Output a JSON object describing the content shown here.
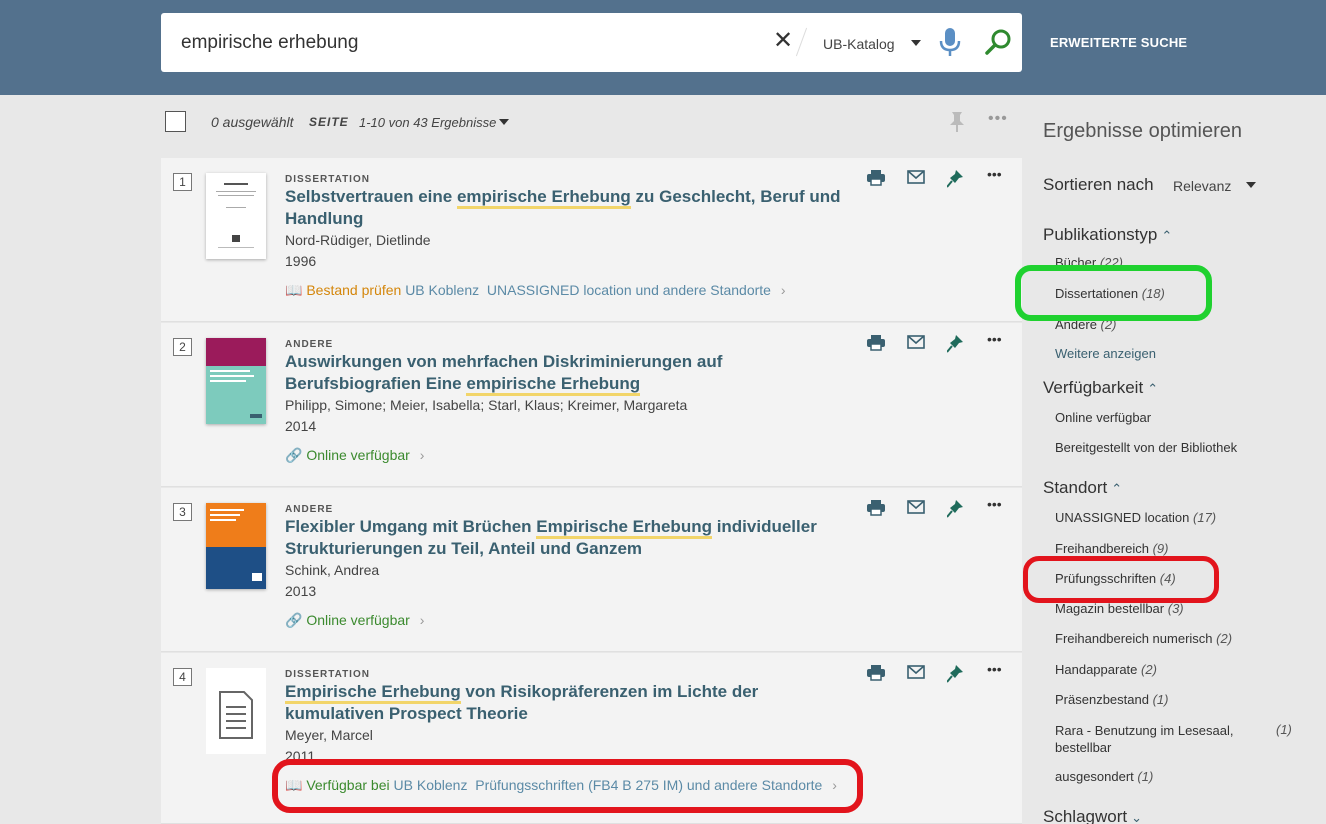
{
  "search": {
    "query": "empirische erhebung",
    "scope": "UB-Katalog",
    "advanced_label": "ERWEITERTE SUCHE"
  },
  "toolbar": {
    "selected": "0 ausgewählt",
    "page_label": "SEITE",
    "range": "1-10 von 43 Ergebnisse"
  },
  "results": [
    {
      "num": "1",
      "type": "DISSERTATION",
      "title_parts": [
        "Selbstvertrauen eine ",
        "empirische Erhebung",
        " zu Geschlecht, Beruf und Handlung"
      ],
      "author": "Nord-Rüdiger, Dietlinde",
      "year": "1996",
      "avail_status": "Bestand prüfen",
      "avail_library": "UB Koblenz",
      "avail_location": "UNASSIGNED location und andere Standorte"
    },
    {
      "num": "2",
      "type": "ANDERE",
      "title_parts": [
        "Auswirkungen von mehrfachen Diskriminierungen auf Berufsbiografien Eine ",
        "empirische Erhebung",
        ""
      ],
      "author": "Philipp, Simone; Meier, Isabella; Starl, Klaus; Kreimer, Margareta",
      "year": "2014",
      "avail_status": "Online verfügbar"
    },
    {
      "num": "3",
      "type": "ANDERE",
      "title_parts": [
        "Flexibler Umgang mit Brüchen ",
        "Empirische Erhebung",
        " individueller Strukturierungen zu Teil, Anteil und Ganzem"
      ],
      "author": "Schink, Andrea",
      "year": "2013",
      "avail_status": "Online verfügbar"
    },
    {
      "num": "4",
      "type": "DISSERTATION",
      "title_parts": [
        "",
        "Empirische Erhebung",
        " von Risikopräferenzen im Lichte der kumulativen Prospect Theorie"
      ],
      "author": "Meyer, Marcel",
      "year": "2011",
      "avail_status": "Verfügbar bei",
      "avail_library": "UB Koblenz",
      "avail_location": "Prüfungsschriften (FB4 B 275 IM) und andere Standorte"
    }
  ],
  "sidebar": {
    "title": "Ergebnisse optimieren",
    "sort_label": "Sortieren nach",
    "sort_value": "Relevanz",
    "pubtype_head": "Publikationstyp",
    "pubtype": [
      {
        "label": "Bücher",
        "count": "(22)"
      },
      {
        "label": "Dissertationen",
        "count": "(18)"
      },
      {
        "label": "Andere",
        "count": "(2)"
      }
    ],
    "more_label": "Weitere anzeigen",
    "avail_head": "Verfügbarkeit",
    "avail": [
      "Online verfügbar",
      "Bereitgestellt von der Bibliothek"
    ],
    "standort_head": "Standort",
    "standort": [
      {
        "label": "UNASSIGNED location",
        "count": "(17)"
      },
      {
        "label": "Freihandbereich",
        "count": "(9)"
      },
      {
        "label": "Prüfungsschriften",
        "count": "(4)"
      },
      {
        "label": "Magazin bestellbar",
        "count": "(3)"
      },
      {
        "label": "Freihandbereich numerisch",
        "count": "(2)"
      },
      {
        "label": "Handapparate",
        "count": "(2)"
      },
      {
        "label": "Präsenzbestand",
        "count": "(1)"
      }
    ],
    "rara_label_1": "Rara - Benutzung im Lesesaal,",
    "rara_label_2": "bestellbar",
    "rara_count": "(1)",
    "ausgesondert": {
      "label": "ausgesondert",
      "count": "(1)"
    },
    "schlagwort_head": "Schlagwort"
  }
}
